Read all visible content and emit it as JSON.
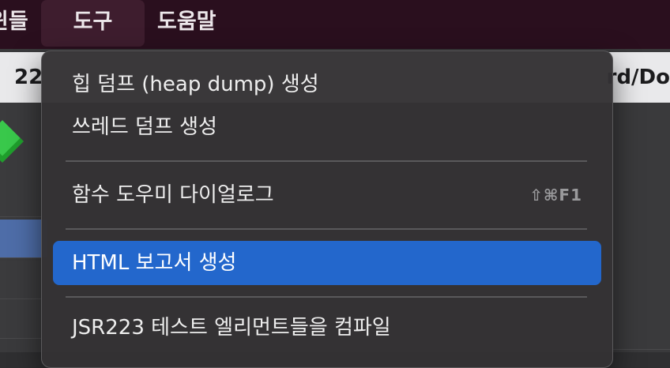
{
  "menubar": {
    "items": [
      {
        "label": "윈들",
        "id": "partial"
      },
      {
        "label": "도구",
        "id": "tools"
      },
      {
        "label": "도움말",
        "id": "help"
      }
    ]
  },
  "app": {
    "path_left": "22",
    "path_right": "rd/Do"
  },
  "menu": {
    "items": [
      {
        "label": "힙 덤프 (heap dump) 생성"
      },
      {
        "label": "쓰레드 덤프 생성"
      },
      {
        "label": "함수 도우미 다이얼로그",
        "shortcut": "⇧⌘F1"
      },
      {
        "label": "HTML 보고서 생성",
        "highlighted": true
      },
      {
        "label": "JSR223 테스트 엘리먼트들을 컴파일"
      }
    ]
  },
  "colors": {
    "menubar_bg": "#2a0f1e",
    "highlight": "#2367cc",
    "menu_bg": "#343234"
  }
}
